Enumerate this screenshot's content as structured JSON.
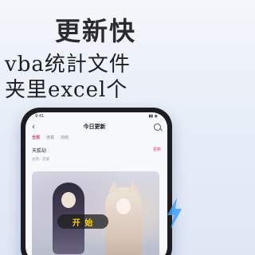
{
  "promo": {
    "headline": "更新快",
    "overlay_line1": "vba统計文件",
    "overlay_line2": "夹里excel个"
  },
  "phone": {
    "status_time": "9:41",
    "status_icons": "▮▮ ◉",
    "nav": {
      "back_icon": "chevron-left-icon",
      "title": "今日更新",
      "search_icon": "search-icon"
    },
    "tabs": [
      "全部",
      "连载",
      "完结"
    ],
    "card": {
      "title": "天狐劫",
      "badge": "更新",
      "subtitle": "古风 · 恋爱"
    },
    "play_label": "开 始"
  },
  "colors": {
    "accent": "#e0407a",
    "play_text": "#ffd400"
  }
}
